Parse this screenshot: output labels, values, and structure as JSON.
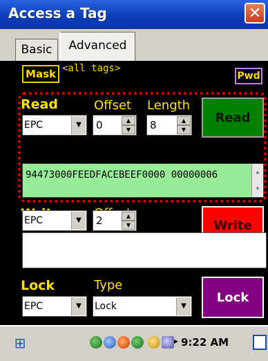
{
  "window": {
    "title": "Access a Tag",
    "close_label": "✕"
  },
  "tabs": [
    {
      "label": "Basic"
    },
    {
      "label": "Advanced"
    }
  ],
  "mask": {
    "button_label": "Mask",
    "value": "<all tags>",
    "pwd_label": "Pwd"
  },
  "read": {
    "section_label": "Read",
    "offset_label": "Offset",
    "length_label": "Length",
    "bank": "EPC",
    "offset": "0",
    "length": "8",
    "button_label": "Read",
    "data": "94473000FEEDFACEBEEF0000 00000006"
  },
  "write": {
    "section_label": "Write",
    "offset_label": "Offset",
    "bank": "EPC",
    "offset": "2",
    "data": "",
    "button_label": "Write"
  },
  "lock": {
    "section_label": "Lock",
    "type_label": "Type",
    "bank": "EPC",
    "type": "Lock",
    "button_label": "Lock"
  },
  "taskbar": {
    "clock": "9:22 AM"
  },
  "colors": {
    "titlebar": "#0a3bb8",
    "read_button": "#008000",
    "write_button": "#ff0000",
    "lock_button": "#800080",
    "data_field": "#98ec98",
    "label": "#ffe000"
  }
}
